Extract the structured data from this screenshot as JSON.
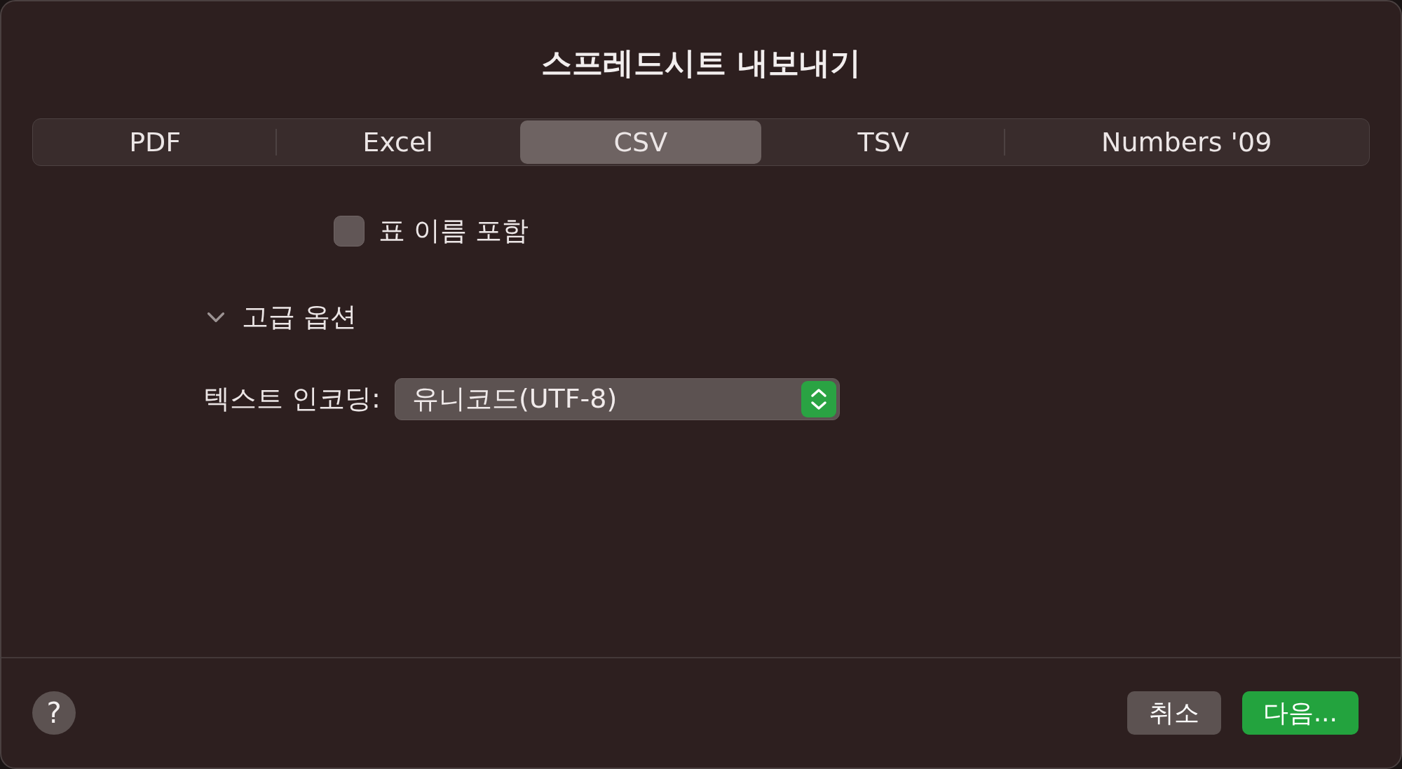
{
  "window": {
    "title": "스프레드시트 내보내기"
  },
  "tabs": [
    {
      "label": "PDF",
      "selected": false
    },
    {
      "label": "Excel",
      "selected": false
    },
    {
      "label": "CSV",
      "selected": true
    },
    {
      "label": "TSV",
      "selected": false
    },
    {
      "label": "Numbers '09",
      "selected": false
    }
  ],
  "include_table_names": {
    "label": "표 이름 포함",
    "checked": false
  },
  "advanced_options": {
    "label": "고급 옵션",
    "expanded": true
  },
  "text_encoding": {
    "label": "텍스트 인코딩:",
    "value": "유니코드(UTF-8)"
  },
  "help_button": {
    "label": "?"
  },
  "buttons": [
    {
      "label": "취소",
      "kind": "secondary"
    },
    {
      "label": "다음...",
      "kind": "primary"
    }
  ]
}
